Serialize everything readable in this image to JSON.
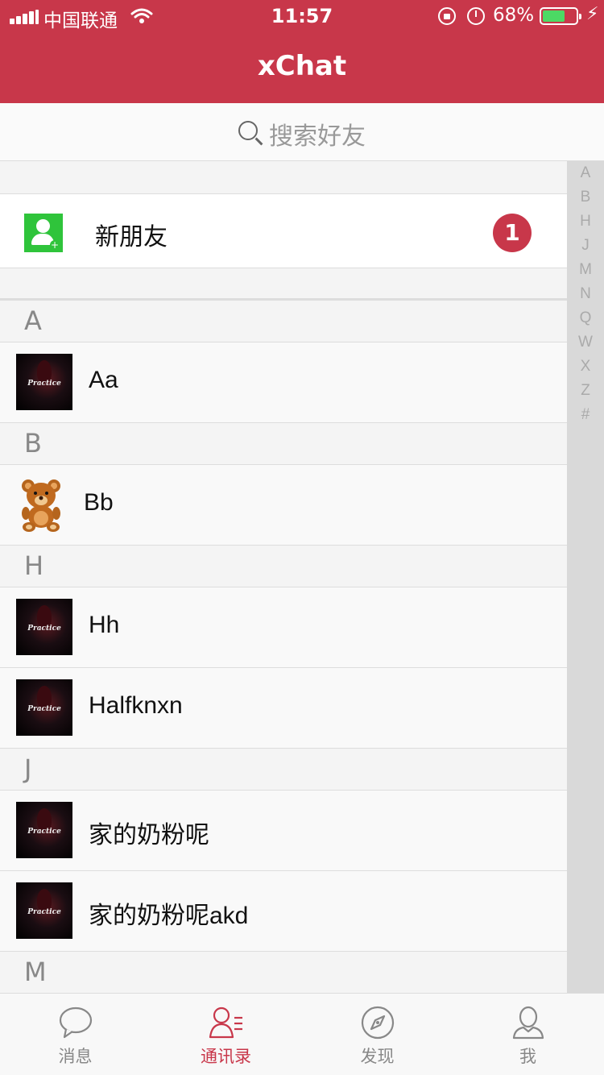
{
  "status_bar": {
    "carrier": "中国联通",
    "time": "11:57",
    "battery_percent": "68%",
    "battery_level": 0.68
  },
  "nav": {
    "title": "xChat"
  },
  "search": {
    "placeholder": "搜索好友"
  },
  "new_friend": {
    "label": "新朋友",
    "badge": "1"
  },
  "sections": [
    {
      "letter": "A",
      "contacts": [
        {
          "name": "Aa",
          "avatar": "practice-avatar"
        }
      ]
    },
    {
      "letter": "B",
      "contacts": [
        {
          "name": "Bb",
          "avatar": "teddy-bear-avatar"
        }
      ]
    },
    {
      "letter": "H",
      "contacts": [
        {
          "name": "Hh",
          "avatar": "practice-avatar"
        },
        {
          "name": "Halfknxn",
          "avatar": "practice-avatar"
        }
      ]
    },
    {
      "letter": "J",
      "contacts": [
        {
          "name": "家的奶粉呢",
          "avatar": "practice-avatar"
        },
        {
          "name": "家的奶粉呢akd",
          "avatar": "practice-avatar"
        }
      ]
    },
    {
      "letter": "M",
      "contacts": []
    }
  ],
  "avatar_text": {
    "word": "Practice"
  },
  "index": [
    "A",
    "B",
    "H",
    "J",
    "M",
    "N",
    "Q",
    "W",
    "X",
    "Z",
    "#"
  ],
  "tabs": [
    {
      "label": "消息",
      "icon": "chat-bubble-icon",
      "active": false
    },
    {
      "label": "通讯录",
      "icon": "contacts-icon",
      "active": true
    },
    {
      "label": "发现",
      "icon": "compass-icon",
      "active": false
    },
    {
      "label": "我",
      "icon": "person-icon",
      "active": false
    }
  ],
  "colors": {
    "brand": "#c8374a",
    "badge": "#c8374a",
    "new_friend_icon": "#2fc43b",
    "battery": "#4cd964"
  }
}
